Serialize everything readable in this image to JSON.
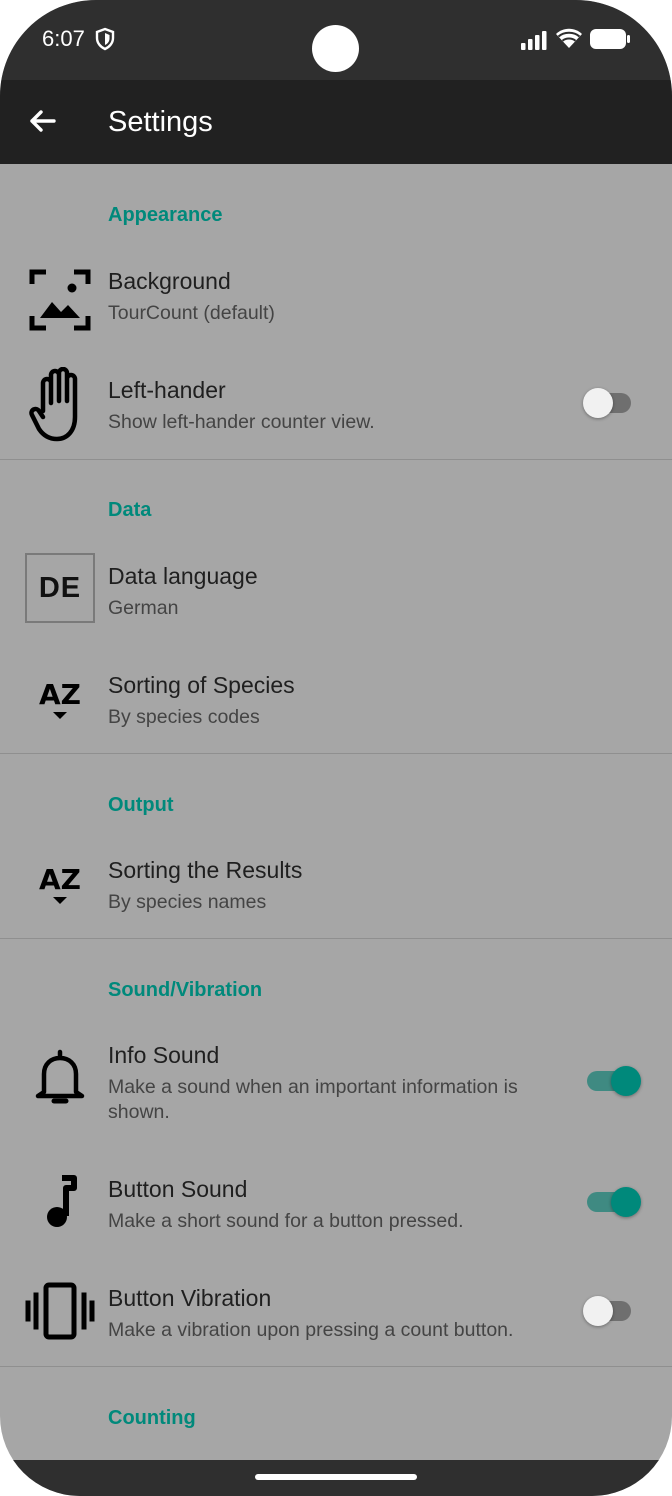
{
  "status": {
    "time": "6:07"
  },
  "toolbar": {
    "title": "Settings"
  },
  "sections": {
    "appearance": {
      "header": "Appearance"
    },
    "data": {
      "header": "Data"
    },
    "output": {
      "header": "Output"
    },
    "sound": {
      "header": "Sound/Vibration"
    },
    "counting": {
      "header": "Counting"
    }
  },
  "prefs": {
    "background": {
      "title": "Background",
      "summary": "TourCount (default)",
      "icon": "image-frame-icon"
    },
    "left_hander": {
      "title": "Left-hander",
      "summary": "Show left-hander counter view.",
      "icon": "hand-icon",
      "enabled": false
    },
    "data_language": {
      "title": "Data language",
      "summary": "German",
      "icon_text": "DE"
    },
    "sorting_species": {
      "title": "Sorting of Species",
      "summary": "By species codes",
      "icon_text": "AZ"
    },
    "sorting_results": {
      "title": "Sorting the Results",
      "summary": "By species names",
      "icon_text": "AZ"
    },
    "info_sound": {
      "title": "Info Sound",
      "summary": "Make a sound when an important information is shown.",
      "icon": "bell-icon",
      "enabled": true
    },
    "button_sound": {
      "title": "Button Sound",
      "summary": "Make a short sound for a button pressed.",
      "icon": "music-note-icon",
      "enabled": true
    },
    "button_vibration": {
      "title": "Button Vibration",
      "summary": "Make a vibration upon pressing a count button.",
      "icon": "vibration-icon",
      "enabled": false
    }
  },
  "colors": {
    "accent": "#00897b",
    "background": "#a6a6a6",
    "toolbar": "#212121"
  }
}
